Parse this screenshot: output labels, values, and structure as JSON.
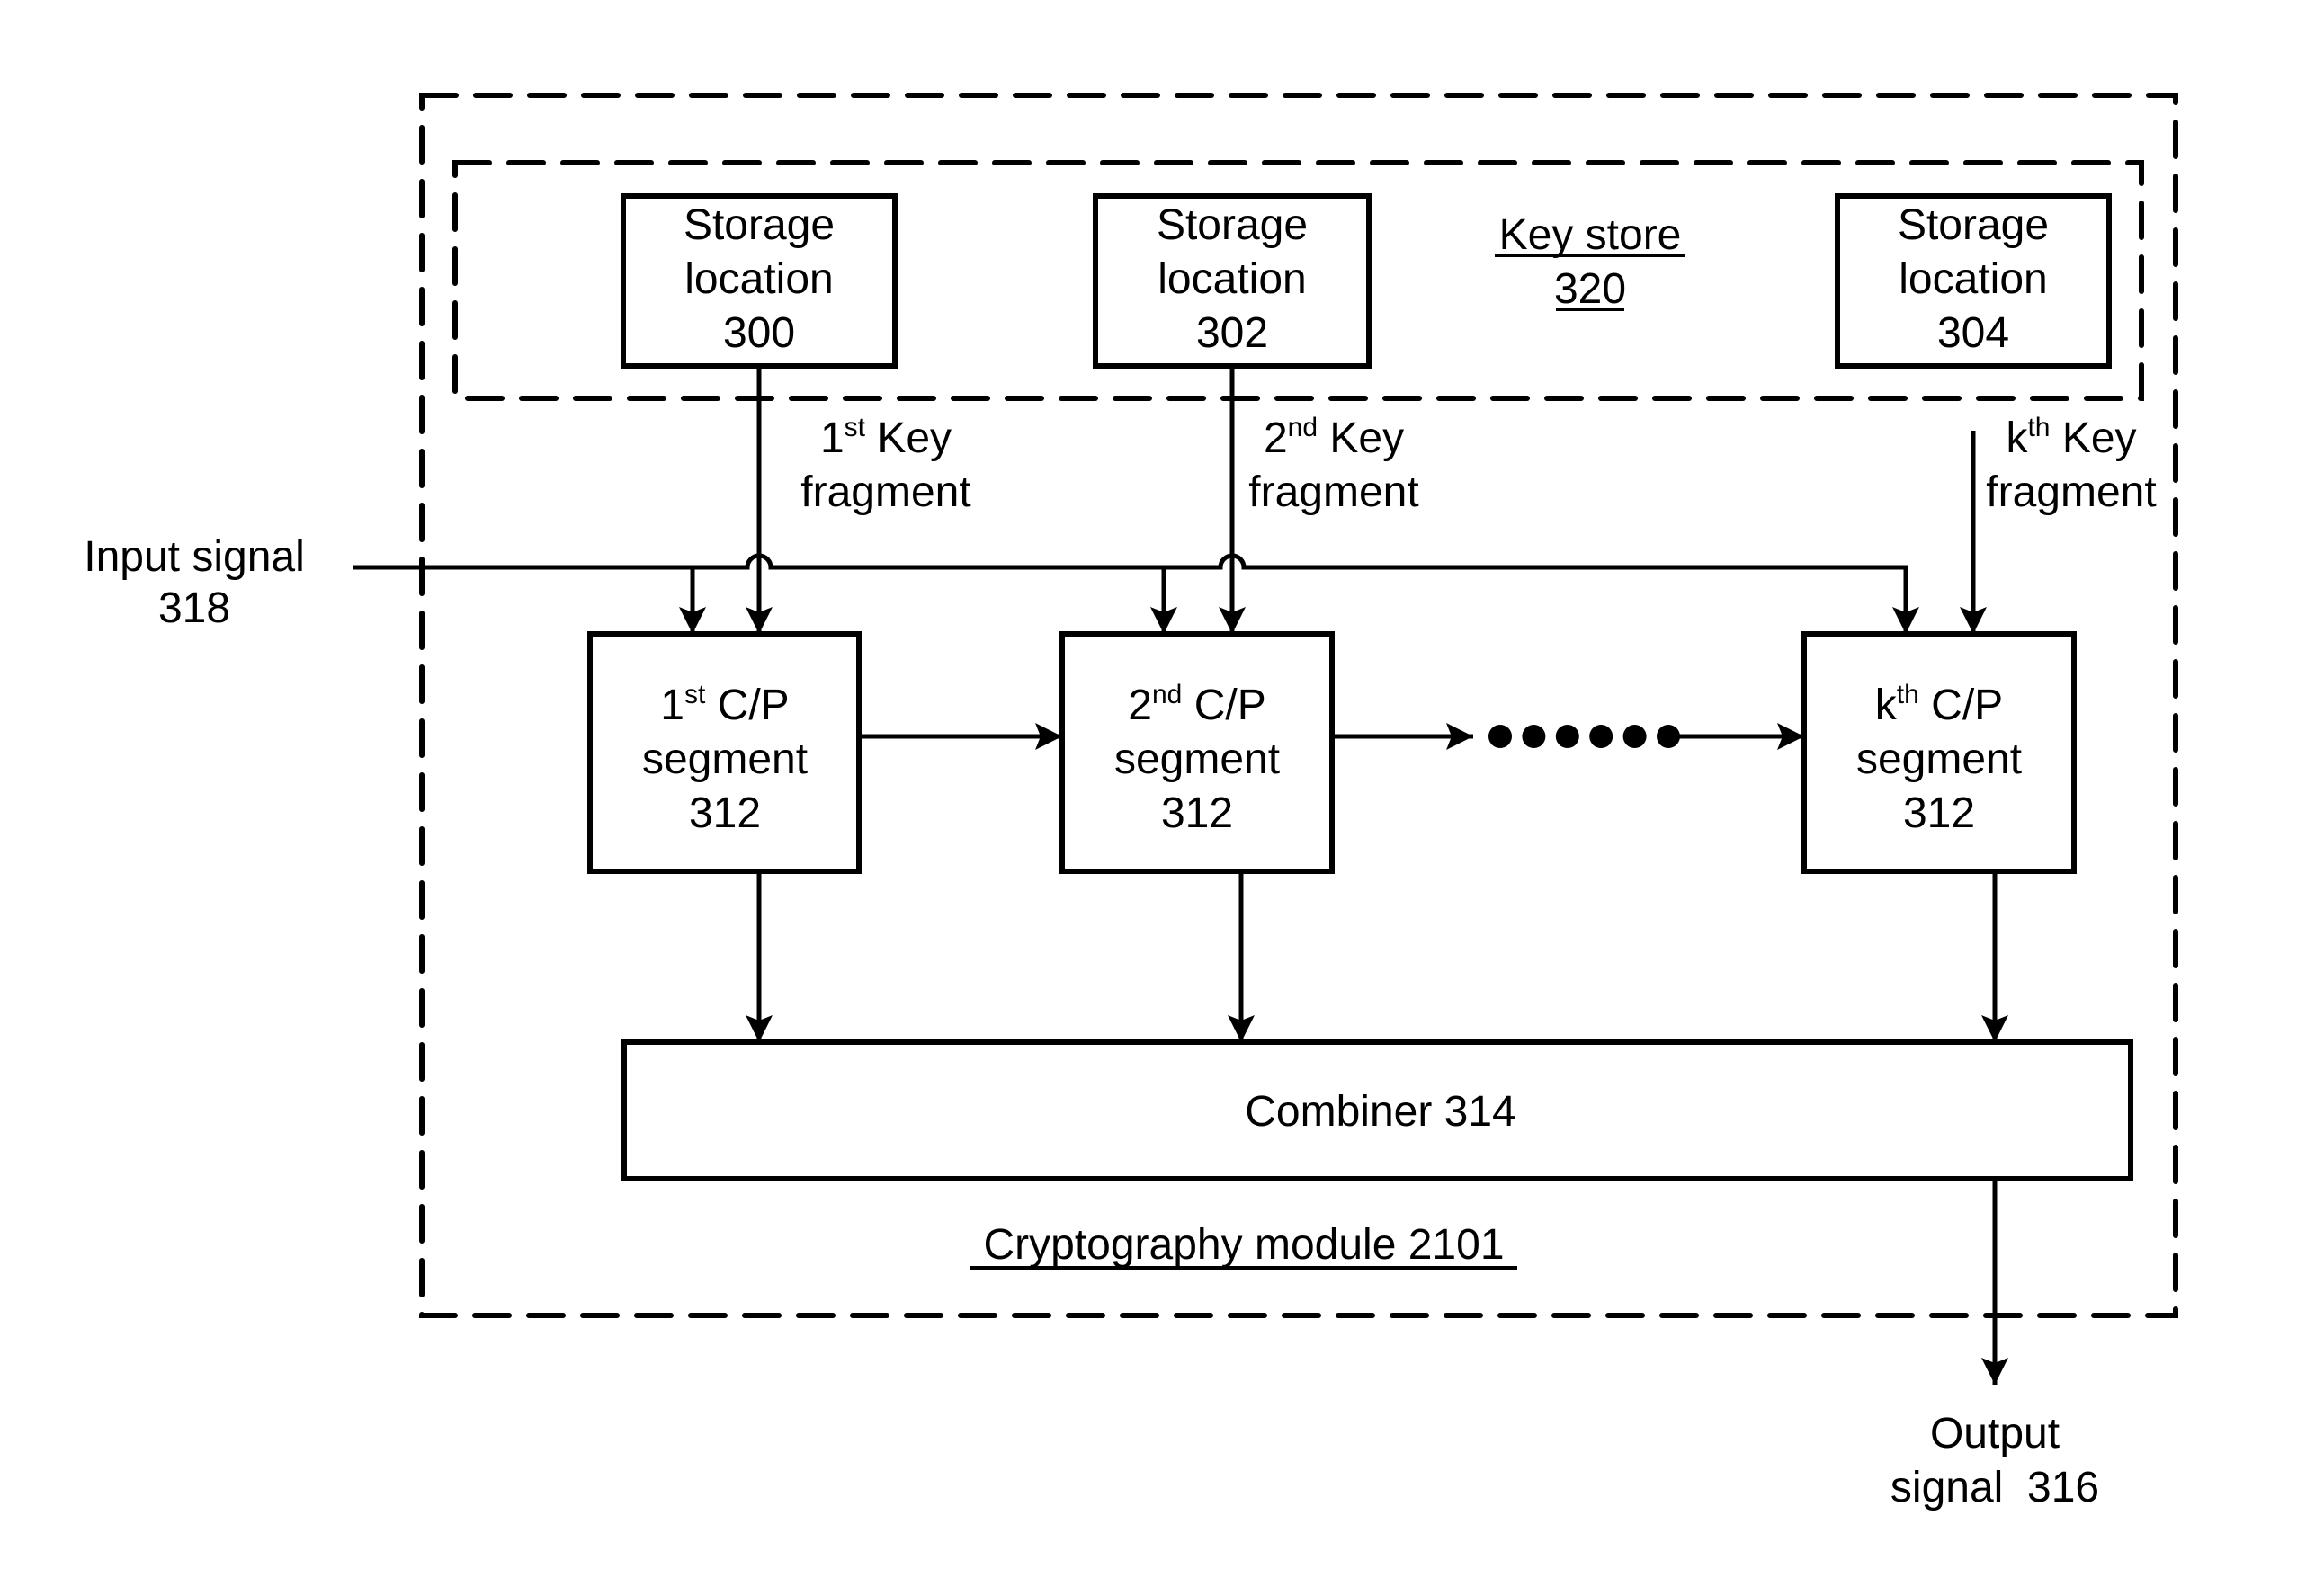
{
  "diagram": {
    "module_label": "Cryptography module 2101",
    "key_store": {
      "label_line1": "Key store",
      "label_line2": "320"
    },
    "storage_locations": [
      {
        "line1": "Storage",
        "line2": "location",
        "line3": "300"
      },
      {
        "line1": "Storage",
        "line2": "location",
        "line3": "302"
      },
      {
        "line1": "Storage",
        "line2": "location",
        "line3": "304"
      }
    ],
    "key_fragments": [
      {
        "ordinal": "1",
        "suffix": "st",
        "line1_rest": " Key",
        "line2": "fragment"
      },
      {
        "ordinal": "2",
        "suffix": "nd",
        "line1_rest": " Key",
        "line2": "fragment"
      },
      {
        "ordinal": "k",
        "suffix": "th",
        "line1_rest": " Key",
        "line2": "fragment"
      }
    ],
    "segments": [
      {
        "ordinal": "1",
        "suffix": "st",
        "line1_rest": " C/P",
        "line2": "segment",
        "line3": "312"
      },
      {
        "ordinal": "2",
        "suffix": "nd",
        "line1_rest": " C/P",
        "line2": "segment",
        "line3": "312"
      },
      {
        "ordinal": "k",
        "suffix": "th",
        "line1_rest": " C/P",
        "line2": "segment",
        "line3": "312"
      }
    ],
    "ellipsis_dot_count": 6,
    "combiner_label": "Combiner 314",
    "input_signal": {
      "line1": "Input signal",
      "line2": "318"
    },
    "output_signal": {
      "line1": "Output",
      "line2": "signal  316"
    }
  }
}
